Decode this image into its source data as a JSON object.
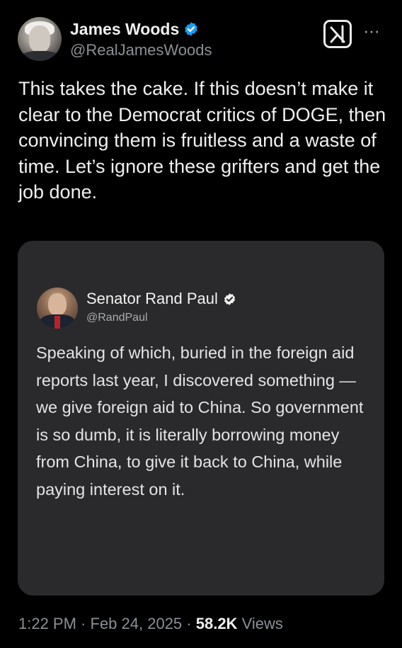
{
  "post": {
    "author": {
      "name": "James Woods",
      "handle": "@RealJamesWoods",
      "verified": true
    },
    "text": "This takes the cake. If this doesn’t make it clear to the Democrat critics of DOGE, then convincing them is fruitless and a waste of time. Let’s ignore these grifters and get the job done.",
    "grok_icon": "grok-icon",
    "more_icon": "more-icon",
    "more_label": "···"
  },
  "quoted": {
    "author": {
      "name": "Senator Rand Paul",
      "handle": "@RandPaul",
      "verified": true
    },
    "text": "Speaking of which, buried in the foreign aid reports last year, I discovered something — we give foreign aid to China. So government is so dumb, it is literally borrowing money from China, to give it back to China, while paying interest on it."
  },
  "footer": {
    "time": "1:22 PM",
    "separator": " · ",
    "date": "Feb 24, 2025",
    "separator2": " · ",
    "views_count": "58.2K",
    "views_label": " Views"
  },
  "colors": {
    "background": "#000000",
    "card": "#2a2a2c",
    "verified_blue": "#1d9bf0",
    "muted": "#8b8f95"
  }
}
